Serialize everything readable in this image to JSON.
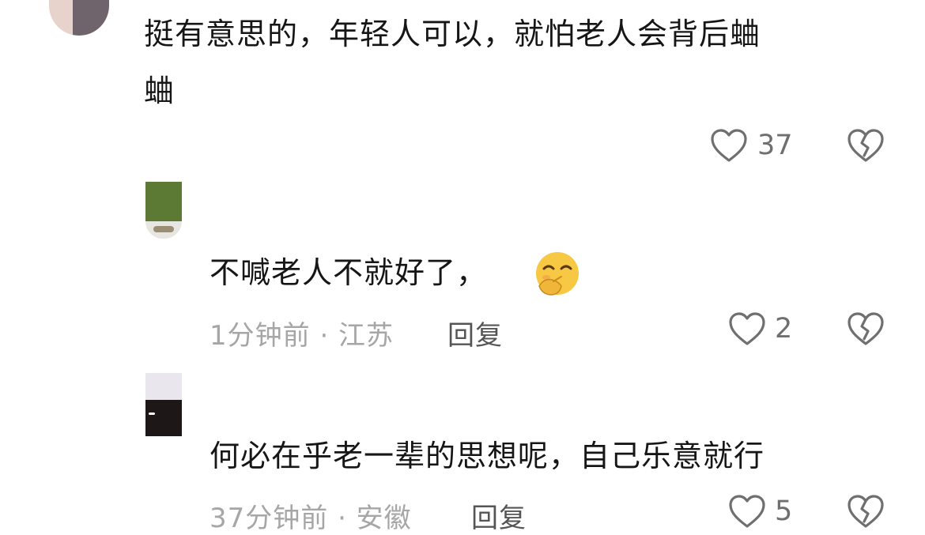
{
  "comments": [
    {
      "text_line1": "挺有意思的，年轻人可以，就怕老人会背后蛐",
      "text_line2": "蛐",
      "likes": "37"
    },
    {
      "text": "不喊老人不就好了，",
      "emoji": "smirk-face-emoji",
      "time_location": "1分钟前 · 江苏",
      "reply_label": "回复",
      "likes": "2"
    },
    {
      "text": "何必在乎老一辈的思想呢，自己乐意就行",
      "time_location": "37分钟前 · 安徽",
      "reply_label": "回复",
      "likes": "5"
    }
  ],
  "icons": {
    "like": "heart-outline-icon",
    "dislike": "broken-heart-icon"
  },
  "colors": {
    "text": "#161616",
    "meta": "#a6a6a6",
    "reply": "#555555",
    "icon": "#6f6f6f"
  }
}
